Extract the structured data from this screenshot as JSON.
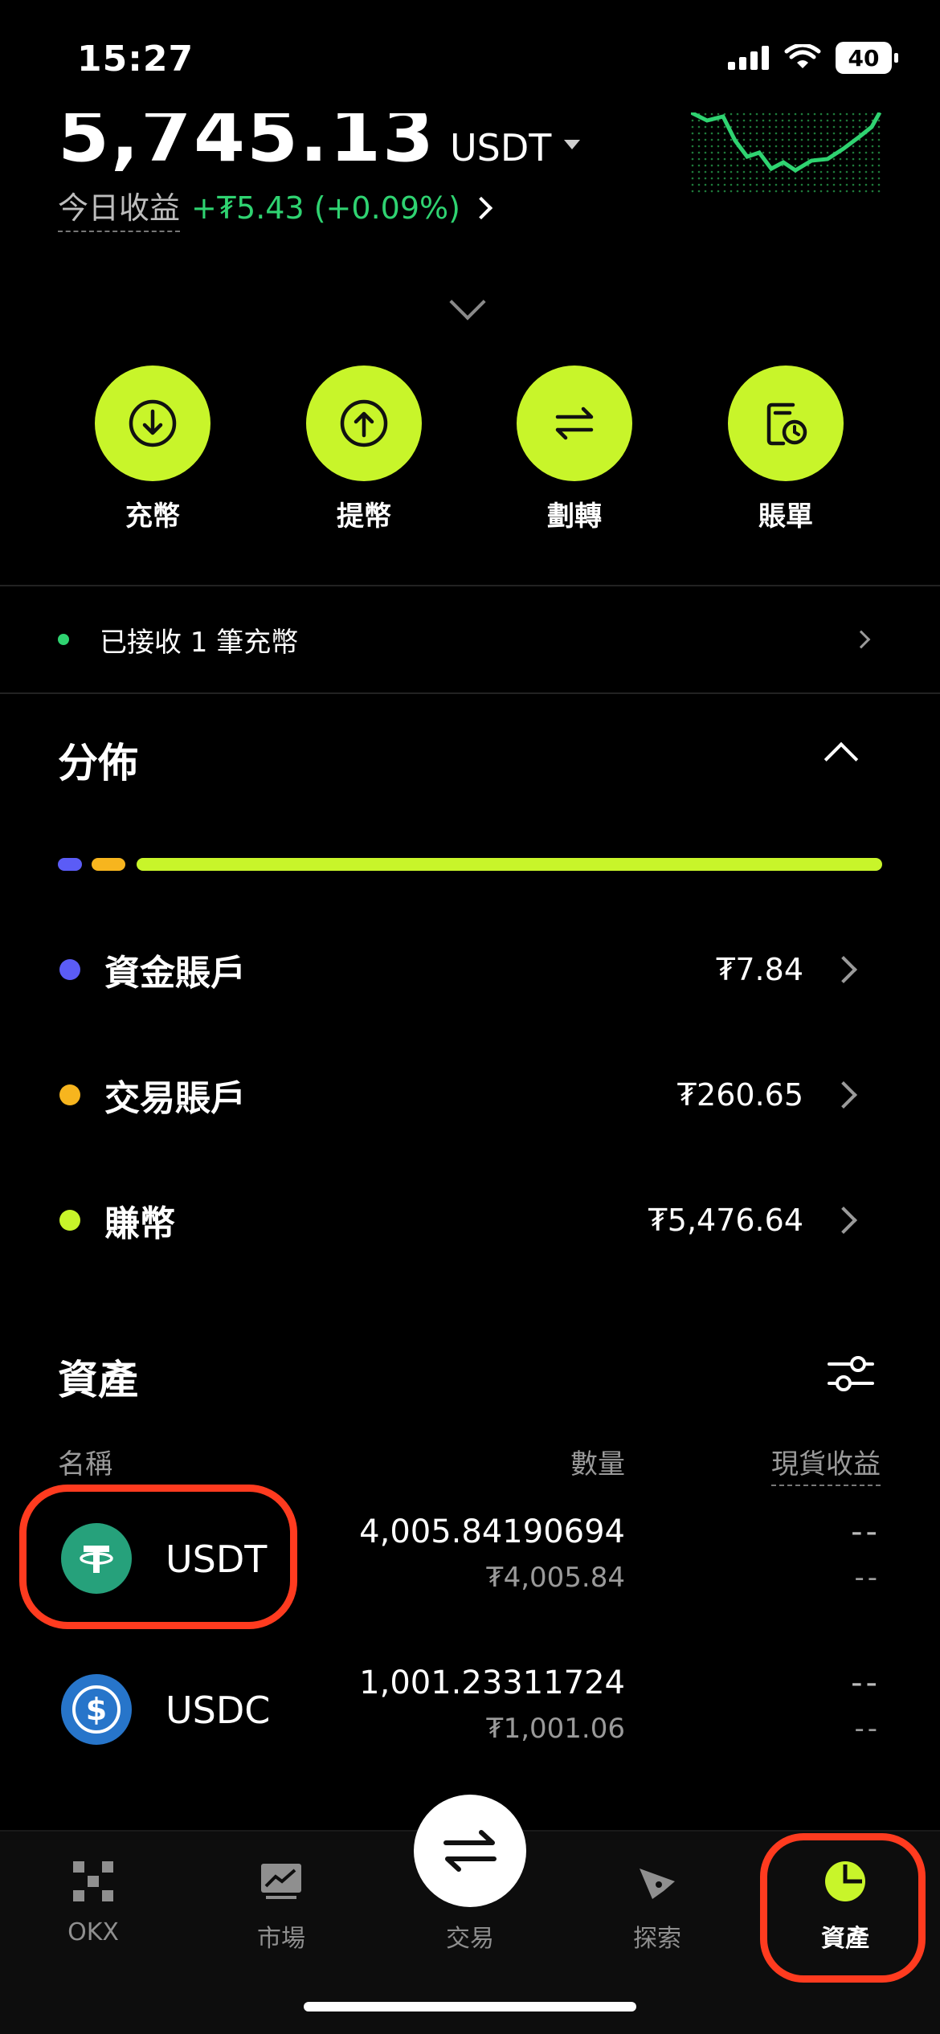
{
  "status_bar": {
    "time": "15:27",
    "battery": "40"
  },
  "balance": {
    "value": "5,745.13",
    "unit": "USDT"
  },
  "today": {
    "label": "今日收益",
    "pnl": "+₮5.43 (+0.09%)"
  },
  "actions": [
    {
      "label": "充幣",
      "icon": "deposit-icon"
    },
    {
      "label": "提幣",
      "icon": "withdraw-icon"
    },
    {
      "label": "劃轉",
      "icon": "transfer-icon"
    },
    {
      "label": "賬單",
      "icon": "bill-icon"
    }
  ],
  "notice": {
    "text": "已接收 1 筆充幣"
  },
  "distribution": {
    "title": "分佈",
    "accounts": [
      {
        "name": "資金賬戶",
        "value": "₮7.84",
        "color": "#5b5cf6"
      },
      {
        "name": "交易賬戶",
        "value": "₮260.65",
        "color": "#f7b51e"
      },
      {
        "name": "賺幣",
        "value": "₮5,476.64",
        "color": "#c8f52a"
      }
    ]
  },
  "assets": {
    "title": "資產",
    "columns": {
      "name": "名稱",
      "qty": "數量",
      "pnl": "現貨收益"
    },
    "rows": [
      {
        "symbol": "USDT",
        "qty": "4,005.84190694",
        "value": "₮4,005.84",
        "pnl": "--",
        "pnl2": "--",
        "icon_color": "#26a17b"
      },
      {
        "symbol": "USDC",
        "qty": "1,001.23311724",
        "value": "₮1,001.06",
        "pnl": "--",
        "pnl2": "--",
        "icon_color": "#2775ca"
      }
    ]
  },
  "nav": [
    {
      "label": "OKX",
      "icon": "okx-logo-icon"
    },
    {
      "label": "市場",
      "icon": "market-chart-icon"
    },
    {
      "label": "交易",
      "icon": "trade-swap-icon"
    },
    {
      "label": "探索",
      "icon": "compass-icon"
    },
    {
      "label": "資產",
      "icon": "pie-chart-icon"
    }
  ],
  "colors": {
    "accent": "#c8f52a",
    "positive": "#2fd371",
    "highlight": "#ff3b1f"
  }
}
